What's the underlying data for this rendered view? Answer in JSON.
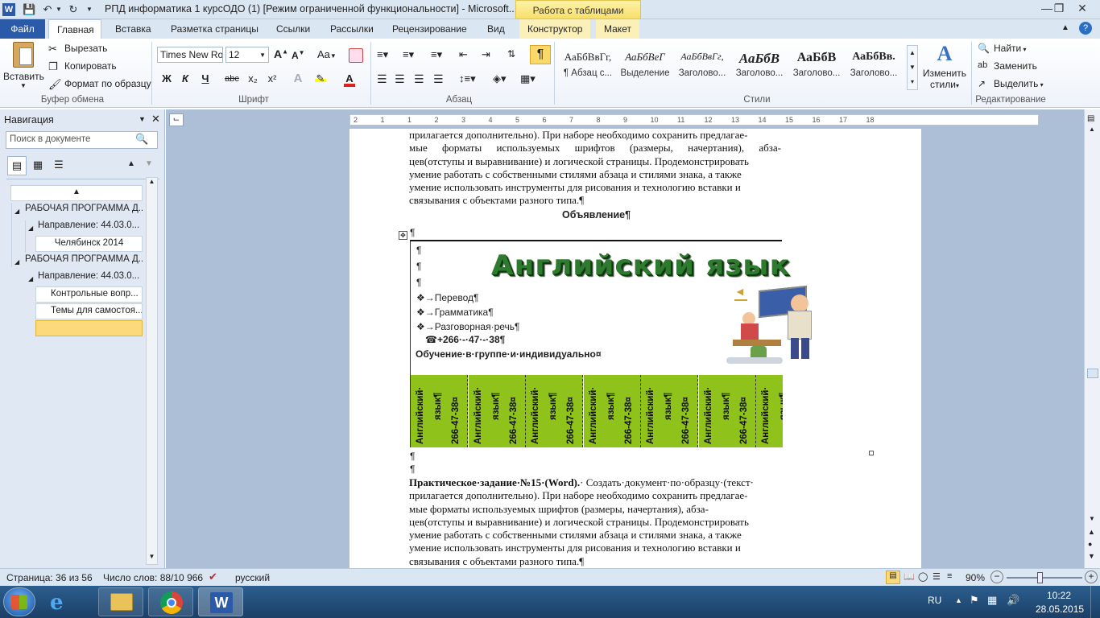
{
  "window": {
    "title": "РПД информатика 1 курсОДО (1) [Режим ограниченной функциональности]  -  Microsoft...",
    "context_tab_header": "Работа с таблицами"
  },
  "tabs": [
    "Файл",
    "Главная",
    "Вставка",
    "Разметка страницы",
    "Ссылки",
    "Рассылки",
    "Рецензирование",
    "Вид",
    "Конструктор",
    "Макет"
  ],
  "ribbon": {
    "clipboard": {
      "paste": "Вставить",
      "cut": "Вырезать",
      "copy": "Копировать",
      "format_painter": "Формат по образцу",
      "label": "Буфер обмена"
    },
    "font": {
      "name": "Times New Ro",
      "size": "12",
      "label": "Шрифт",
      "bold": "Ж",
      "italic": "К",
      "underline": "Ч",
      "strike": "abc",
      "sub": "x₂",
      "sup": "x²",
      "grow": "A",
      "shrink": "A",
      "case": "Aa"
    },
    "paragraph": {
      "label": "Абзац"
    },
    "styles": {
      "label": "Стили",
      "items": [
        {
          "preview": "АаБбВвГг,",
          "name": "¶ Абзац с..."
        },
        {
          "preview": "АаБбВеГ",
          "name": "Выделение"
        },
        {
          "preview": "АаБбВвГг,",
          "name": "Заголово..."
        },
        {
          "preview": "АаБбВ",
          "name": "Заголово..."
        },
        {
          "preview": "АаБбВ",
          "name": "Заголово..."
        },
        {
          "preview": "АаБбВв.",
          "name": "Заголово..."
        }
      ],
      "change_styles_1": "Изменить",
      "change_styles_2": "стили"
    },
    "editing": {
      "find": "Найти",
      "replace": "Заменить",
      "select": "Выделить",
      "label": "Редактирование"
    }
  },
  "navigation": {
    "title": "Навигация",
    "search_placeholder": "Поиск в документе",
    "items": [
      "РАБОЧАЯ ПРОГРАММА Д...",
      "Направление: 44.03.0...",
      "Челябинск 2014",
      "РАБОЧАЯ ПРОГРАММА Д...",
      "Направление: 44.03.0...",
      "Контрольные вопр...",
      "Темы для самостоя..."
    ]
  },
  "document": {
    "para_top": [
      "прилагается дополнительно). При наборе необходимо сохранить предлагае-",
      "мые  форматы  используемых  шрифтов  (размеры,  начертания),  абза-",
      "цев(отступы и выравнивание) и логической страницы. Продемонстрировать",
      "умение работать с собственными стилями абзаца и стилями знака, а также",
      "умение использовать инструменты для рисования и технологию вставки и",
      "связывания с объектами разного типа.¶"
    ],
    "heading": "Объявление¶",
    "pilcrow": "¶",
    "ad": {
      "wordart": "Английский язык",
      "bullets": [
        "❖→Перевод¶",
        "❖→Грамматика¶",
        "❖→Разговорная·речь¶"
      ],
      "phone": "☎+266·-·47·-·38¶",
      "note": "Обучение·в·группе·и·индивидуально¤",
      "strip_lines": [
        "Английский·",
        "язык¶",
        "266-47-38¤"
      ]
    },
    "task_bold": "Практическое·задание·№15·(Word).",
    "task_rest": "· Создать·документ·по·образцу·(текст·",
    "para_bottom": [
      "прилагается дополнительно). При наборе необходимо сохранить предлагае-",
      "мые  форматы  используемых  шрифтов  (размеры,  начертания),  абза-",
      "цев(отступы и выравнивание) и логической страницы. Продемонстрировать",
      "умение работать с собственными стилями абзаца и стилями знака, а также",
      "умение использовать инструменты для рисования и технологию вставки и",
      "связывания с объектами разного типа.¶"
    ]
  },
  "ruler_ticks": [
    "2",
    "1",
    "1",
    "2",
    "3",
    "4",
    "5",
    "6",
    "7",
    "8",
    "9",
    "10",
    "11",
    "12",
    "13",
    "14",
    "15",
    "16",
    "17",
    "18"
  ],
  "status": {
    "page": "Страница: 36 из 56",
    "words": "Число слов: 88/10 966",
    "lang": "русский",
    "zoom": "90%"
  },
  "taskbar": {
    "lang": "RU",
    "time": "10:22",
    "date": "28.05.2015"
  },
  "colors": {
    "accent": "#2a5aa8",
    "strip_green": "#8fc21a",
    "wordart_green": "#2e7a2e",
    "nav_active": "#fcd97a"
  }
}
